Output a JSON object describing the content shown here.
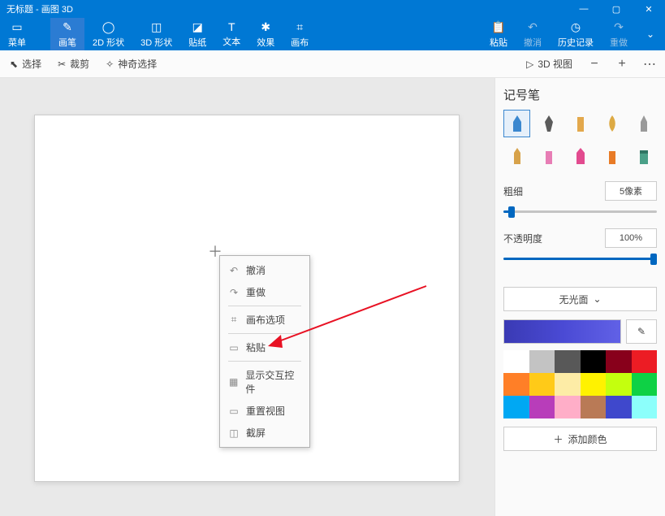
{
  "title": "无标题 - 画图 3D",
  "winbuttons": {
    "min": "—",
    "max": "▢",
    "close": "✕"
  },
  "ribbon": {
    "menu": "菜单",
    "brush": "画笔",
    "shape2d": "2D 形状",
    "shape3d": "3D 形状",
    "sticker": "贴纸",
    "text": "文本",
    "effect": "效果",
    "canvas": "画布",
    "paste": "粘贴",
    "undo": "撤消",
    "history": "历史记录",
    "redo": "重做",
    "expand": "⌄"
  },
  "subtool": {
    "select": "选择",
    "crop": "裁剪",
    "magic": "神奇选择",
    "view3d": "3D 视图",
    "minus": "−",
    "plus": "+",
    "more": "⋯"
  },
  "panel": {
    "title": "记号笔",
    "thick_label": "粗细",
    "thick_value": "5像素",
    "opacity_label": "不透明度",
    "opacity_value": "100%",
    "matte": "无光面",
    "addcolor": "添加颜色"
  },
  "swatches": [
    "#ffffff",
    "#c3c3c3",
    "#585858",
    "#000000",
    "#88001b",
    "#ec1c24",
    "#ff7f27",
    "#ffca18",
    "#fdeca6",
    "#fff200",
    "#c4ff0e",
    "#0ed145",
    "#00a8f3",
    "#b83dba",
    "#ffaec8",
    "#b97a56",
    "#3f48cc",
    "#8cfffb"
  ],
  "ctxmenu": {
    "undo": "撤消",
    "redo": "重做",
    "canvas_opts": "画布选项",
    "paste": "粘贴",
    "show_interactive": "显示交互控件",
    "reset_view": "重置视图",
    "screenshot": "截屏"
  }
}
